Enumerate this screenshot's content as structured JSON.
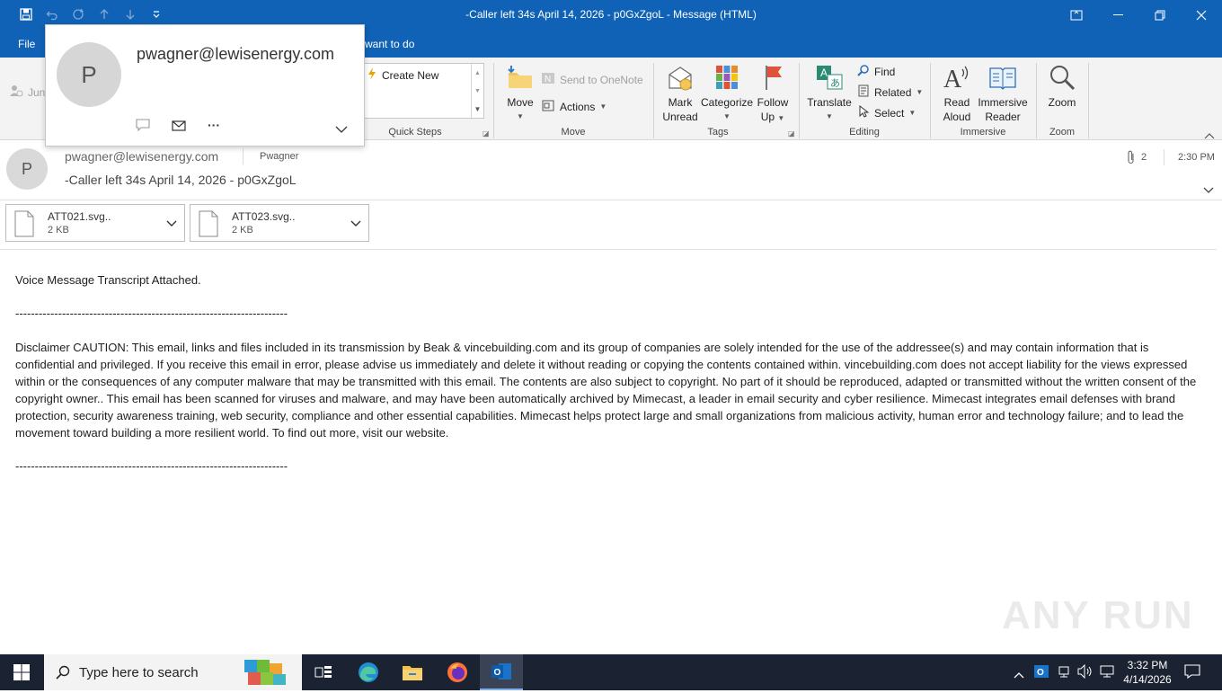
{
  "window": {
    "title": "-Caller left 34s April 14, 2026 - p0GxZgoL  -  Message (HTML)"
  },
  "tabs": {
    "file": "File",
    "tell_me": "want to do"
  },
  "ribbon": {
    "junk_label": "Junk",
    "quick_steps": {
      "create_new": "Create New",
      "group_label": "Quick Steps"
    },
    "move": {
      "move_label": "Move",
      "send_to_onenote": "Send to OneNote",
      "actions": "Actions",
      "group_label": "Move"
    },
    "tags": {
      "mark_unread_line1": "Mark",
      "mark_unread_line2": "Unread",
      "categorize": "Categorize",
      "follow_up_line1": "Follow",
      "follow_up_line2": "Up",
      "group_label": "Tags"
    },
    "editing": {
      "translate": "Translate",
      "find": "Find",
      "related": "Related",
      "select": "Select",
      "group_label": "Editing"
    },
    "immersive": {
      "read_aloud_line1": "Read",
      "read_aloud_line2": "Aloud",
      "immersive_reader_line1": "Immersive",
      "immersive_reader_line2": "Reader",
      "group_label": "Immersive"
    },
    "zoom": {
      "zoom_label": "Zoom",
      "group_label": "Zoom"
    }
  },
  "contact_card": {
    "initial": "P",
    "email": "pwagner@lewisenergy.com"
  },
  "message": {
    "sender_initial": "P",
    "from": "pwagner@lewisenergy.com",
    "to": "Pwagner",
    "subject": "-Caller left 34s April 14, 2026 - p0GxZgoL",
    "attachment_count": "2",
    "time": "2:30 PM",
    "attachments": [
      {
        "name": "ATT021.svg..",
        "size": "2 KB"
      },
      {
        "name": "ATT023.svg..",
        "size": "2 KB"
      }
    ],
    "body": {
      "line1": "Voice Message Transcript Attached.",
      "divider": "----------------------------------------------------------------------",
      "disclaimer": "Disclaimer CAUTION: This email, links and files included in its transmission by Beak & vincebuilding.com and its group of companies are solely intended for the use of the addressee(s) and may contain information that is confidential and privileged. If you receive this email in error, please advise us immediately and delete it without reading or copying the contents contained within. vincebuilding.com does not accept liability for the views expressed within or the consequences of any computer malware that may be transmitted with this email. The contents are also subject to copyright. No part of it should be reproduced, adapted or transmitted without the written consent of the copyright owner.. This email has been scanned for viruses and malware, and may have been automatically archived by Mimecast, a leader in email security and cyber resilience. Mimecast integrates email defenses with brand protection, security awareness training, web security, compliance and other essential capabilities. Mimecast helps protect large and small organizations from malicious activity, human error and technology failure; and to lead the movement toward building a more resilient world. To find out more, visit our website.",
      "divider2": "----------------------------------------------------------------------"
    }
  },
  "watermark": "ANY RUN",
  "taskbar": {
    "search_placeholder": "Type here to search",
    "clock_time": "3:32 PM",
    "clock_date": "4/14/2026"
  }
}
